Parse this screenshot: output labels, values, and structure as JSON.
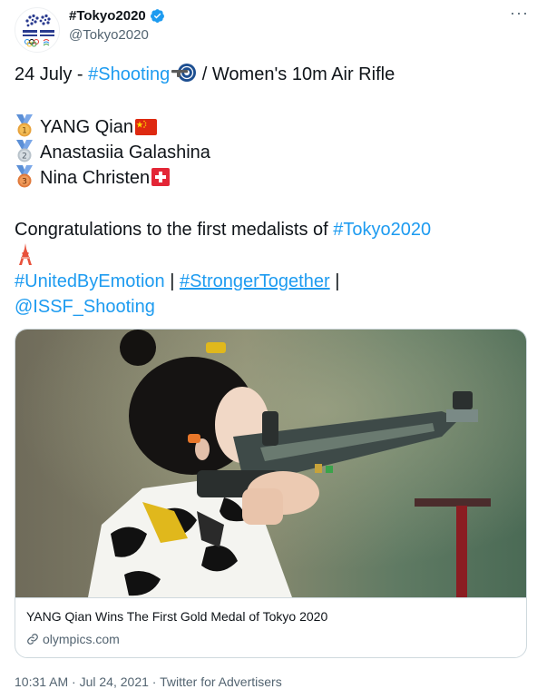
{
  "account": {
    "name": "#Tokyo2020",
    "handle": "@Tokyo2020",
    "avatar_text": "TOKYO 2020",
    "more_label": "···"
  },
  "tweet": {
    "line1_date": "24 July - ",
    "line1_hashtag": "#Shooting",
    "line1_event": "  / Women's 10m Air Rifle",
    "medalists": [
      {
        "rank": "1",
        "name": "YANG Qian",
        "medal_color": "#e8a33c",
        "flag": "china-flag"
      },
      {
        "rank": "2",
        "name": "Anastasiia Galashina",
        "medal_color": "#b9c3cb",
        "flag": ""
      },
      {
        "rank": "3",
        "name": "Nina Christen",
        "medal_color": "#e07a3c",
        "flag": "swiss-flag"
      }
    ],
    "congrats_text": "Congratulations to the first medalists of  ",
    "congrats_hashtag": "#Tokyo2020",
    "tag_united": "#UnitedByEmotion",
    "separator": " | ",
    "tag_stronger": "#StrongerTogether",
    "separator_end": " |",
    "mention": "@ISSF_Shooting"
  },
  "card": {
    "title": "YANG Qian Wins The First Gold Medal of Tokyo 2020",
    "domain": "olympics.com"
  },
  "meta": {
    "time": "10:31 AM",
    "dot1": " · ",
    "date": "Jul 24, 2021",
    "dot2": " · ",
    "source": "Twitter for Advertisers"
  },
  "colors": {
    "link": "#1d9bf0",
    "text": "#0f1419",
    "secondary": "#536471",
    "verified": "#1d9bf0"
  }
}
